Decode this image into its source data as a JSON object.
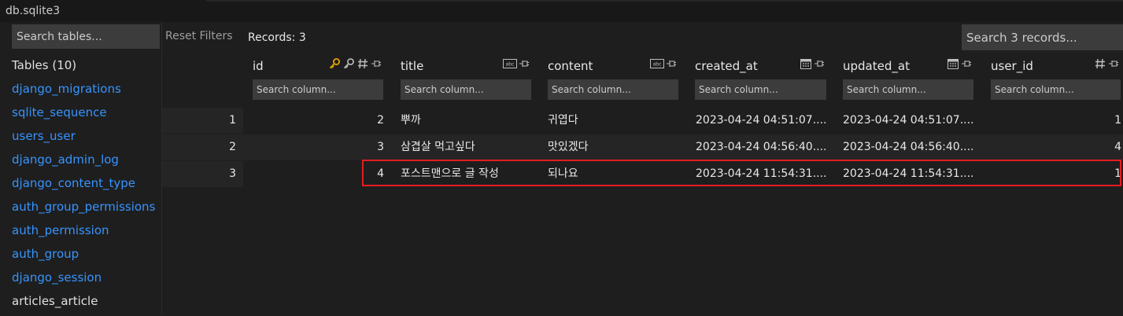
{
  "window": {
    "tab_name": "db.sqlite3"
  },
  "sidebar": {
    "search_placeholder": "Search tables...",
    "heading": "Tables (10)",
    "tables": [
      "django_migrations",
      "sqlite_sequence",
      "users_user",
      "django_admin_log",
      "django_content_type",
      "auth_group_permissions",
      "auth_permission",
      "auth_group",
      "django_session",
      "articles_article"
    ],
    "active_table": "articles_article"
  },
  "toolbar": {
    "reset_filters": "Reset Filters",
    "records": "Records: 3",
    "search_placeholder": "Search 3 records..."
  },
  "columns": [
    {
      "name": "id",
      "type_icons": [
        "key-icon",
        "foreign-key-icon",
        "hash-icon"
      ],
      "filter_placeholder": "Search column..."
    },
    {
      "name": "title",
      "type_icons": [
        "text-type-icon"
      ],
      "filter_placeholder": "Search column..."
    },
    {
      "name": "content",
      "type_icons": [
        "text-type-icon"
      ],
      "filter_placeholder": "Search column..."
    },
    {
      "name": "created_at",
      "type_icons": [
        "calendar-icon"
      ],
      "filter_placeholder": "Search column..."
    },
    {
      "name": "updated_at",
      "type_icons": [
        "calendar-icon"
      ],
      "filter_placeholder": "Search column..."
    },
    {
      "name": "user_id",
      "type_icons": [
        "hash-icon"
      ],
      "filter_placeholder": "Search column..."
    }
  ],
  "rows": [
    {
      "rownum": "1",
      "id": "2",
      "title": "뿌까",
      "content": "귀엽다",
      "created_at": "2023-04-24 04:51:07....",
      "updated_at": "2023-04-24 04:51:07....",
      "user_id": "1"
    },
    {
      "rownum": "2",
      "id": "3",
      "title": "삼겹살 먹고싶다",
      "content": "맛있겠다",
      "created_at": "2023-04-24 04:56:40....",
      "updated_at": "2023-04-24 04:56:40....",
      "user_id": "4"
    },
    {
      "rownum": "3",
      "id": "4",
      "title": "포스트맨으로 글 작성",
      "content": "되나요",
      "created_at": "2023-04-24 11:54:31....",
      "updated_at": "2023-04-24 11:54:31....",
      "user_id": "1"
    }
  ],
  "highlighted_row": 3,
  "colors": {
    "accent_link": "#3794ff",
    "key_icon": "#e8a200",
    "highlight_border": "#e51c23",
    "background": "#1e1e1e",
    "input_bg": "#3c3c3c"
  }
}
